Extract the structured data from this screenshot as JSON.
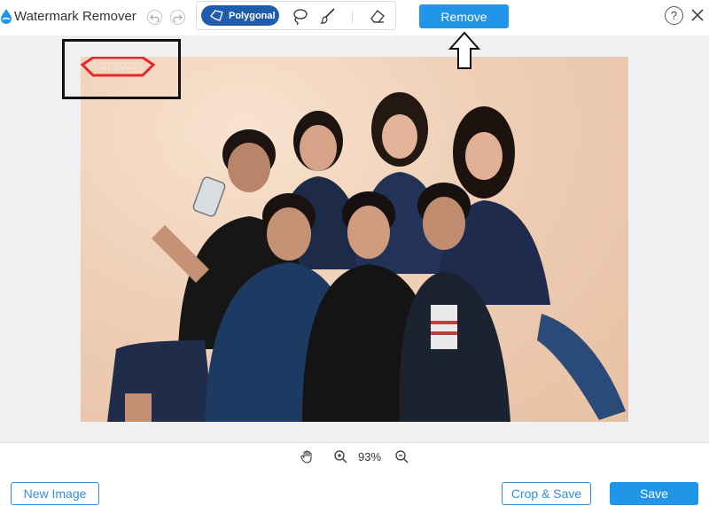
{
  "header": {
    "app_title": "Watermark Remover",
    "undo_icon": "undo-icon",
    "redo_icon": "redo-icon",
    "tools": {
      "polygonal_label": "Polygonal",
      "lasso_icon": "lasso-icon",
      "brush_icon": "brush-icon",
      "eraser_icon": "eraser-icon"
    },
    "remove_label": "Remove",
    "help_label": "?",
    "close_icon": "close-icon"
  },
  "canvas": {
    "watermark_text": "07-27-2022",
    "image_subject": "group-selfie-photo",
    "selection_color": "#e8262b",
    "annotation_box_color": "#111111",
    "arrow_icon": "up-arrow-icon"
  },
  "zoom": {
    "hand_icon": "hand-icon",
    "zoom_in_icon": "zoom-in-icon",
    "zoom_out_icon": "zoom-out-icon",
    "level": "93%"
  },
  "footer": {
    "new_image_label": "New Image",
    "crop_save_label": "Crop & Save",
    "save_label": "Save"
  },
  "colors": {
    "accent": "#2196e8",
    "tool_active": "#1f5cae",
    "canvas_bg": "#eef0f2"
  }
}
